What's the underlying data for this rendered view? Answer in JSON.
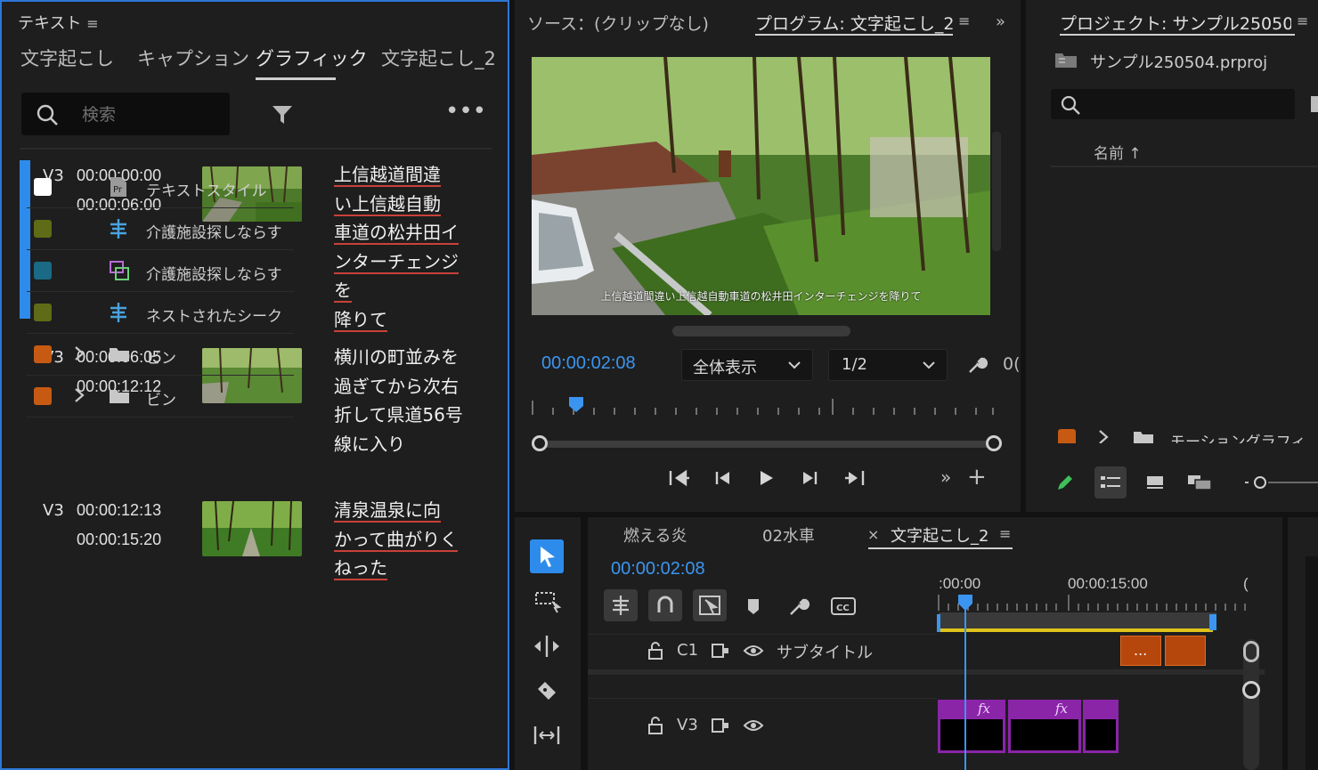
{
  "text_panel": {
    "title": "テキスト",
    "tabs": [
      "文字起こし",
      "キャプション",
      "グラフィック",
      "文字起こし_2"
    ],
    "active_tab": "グラフィック",
    "search_placeholder": "検索",
    "segments": [
      {
        "track": "V3",
        "start": "00:00:00:00",
        "end": "00:00:06:00",
        "text": "上信越道間違い上信越自動車道の松井田インターチェンジを降りて",
        "lines": [
          "上信越道間違",
          "い上信越自動",
          "車道の松井田イ",
          "ンターチェンジを",
          "降りて"
        ]
      },
      {
        "track": "V3",
        "start": "00:00:06:05",
        "end": "00:00:12:12",
        "text": "横川の町並みを過ぎてから次右折して県道56号線に入り",
        "lines": [
          "横川の町並みを",
          "過ぎてから次右",
          "折して県道56号",
          "線に入り"
        ]
      },
      {
        "track": "V3",
        "start": "00:00:12:13",
        "end": "00:00:15:20",
        "text": "清泉温泉に向かって曲がりくねった",
        "lines": [
          "清泉温泉に向",
          "かって曲がりく",
          "ねった"
        ]
      }
    ]
  },
  "program_monitor": {
    "source_label": "ソース：(クリップなし)",
    "program_label": "プログラム: 文字起こし_2",
    "caption_overlay": "上信越道間違い上信越自動車道の松井田インターチェンジを降りて",
    "timecode": "00:00:02:08",
    "zoom_select": "全体表示",
    "resolution_select": "1/2",
    "right_cut_text": "0("
  },
  "project_panel": {
    "title": "プロジェクト: サンプル25050",
    "file_name": "サンプル250504.prproj",
    "column_header": "名前",
    "items": [
      {
        "name": "テキストスタイル",
        "color": "#ffffff",
        "icon": "text-style-icon",
        "expandable": false
      },
      {
        "name": "介護施設探しならす",
        "color": "#5f6b16",
        "icon": "sequence-icon",
        "expandable": false
      },
      {
        "name": "介護施設探しならす",
        "color": "#1a6a86",
        "icon": "multicam-icon",
        "expandable": false
      },
      {
        "name": "ネストされたシーク",
        "color": "#5f6b16",
        "icon": "sequence-icon",
        "expandable": false
      },
      {
        "name": "ビン",
        "color": "#c75a12",
        "icon": "folder-icon",
        "expandable": true
      },
      {
        "name": "ビン",
        "color": "#c75a12",
        "icon": "folder-icon",
        "expandable": true
      },
      {
        "name": "モーショングラフィ",
        "color": "#c75a12",
        "icon": "folder-icon",
        "expandable": true
      }
    ]
  },
  "timeline": {
    "tabs": [
      "燃える炎",
      "02水車",
      "文字起こし_2"
    ],
    "active_tab": "文字起こし_2",
    "timecode": "00:00:02:08",
    "ruler": [
      ":00:00",
      "00:00:15:00"
    ],
    "ruler_cut": "(",
    "tracks": [
      {
        "id": "C1",
        "name": "サブタイトル"
      },
      {
        "id": "V3",
        "name": ""
      }
    ],
    "caption_clip_label": "...",
    "fx_label": "fx"
  },
  "colors": {
    "accent_blue": "#2d8ceb",
    "panel_bg": "#1e1e1e",
    "caption_clip": "#b5470d",
    "graphic_clip": "#8a25a8",
    "work_area": "#e0c21b"
  }
}
